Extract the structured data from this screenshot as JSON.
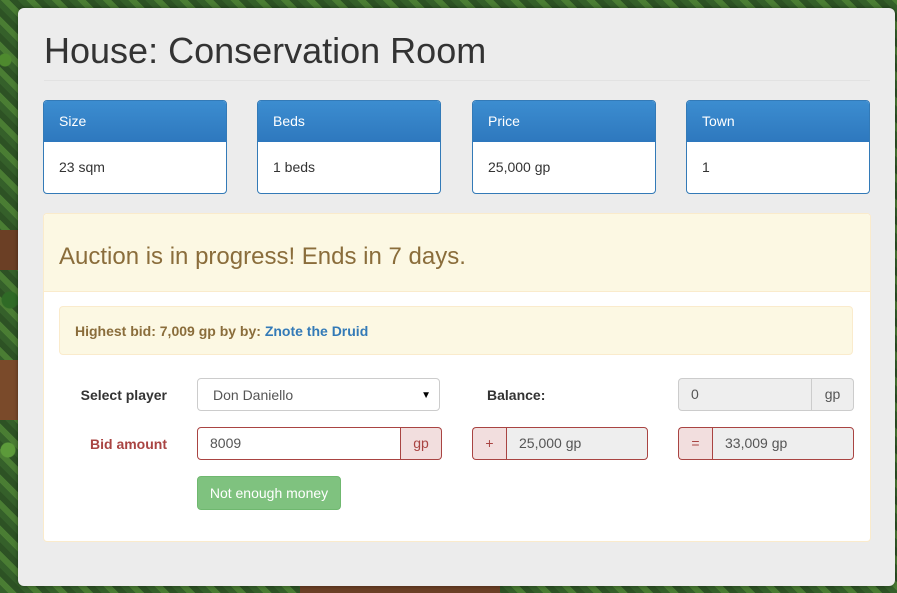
{
  "page": {
    "title": "House: Conservation Room"
  },
  "stats": [
    {
      "label": "Size",
      "value": "23 sqm"
    },
    {
      "label": "Beds",
      "value": "1 beds"
    },
    {
      "label": "Price",
      "value": "25,000 gp"
    },
    {
      "label": "Town",
      "value": "1"
    }
  ],
  "auction": {
    "heading": "Auction is in progress! Ends in 7 days.",
    "highest_bid_text": "Highest bid: 7,009 gp by by:",
    "highest_bidder": "Znote the Druid",
    "select_player_label": "Select player",
    "selected_player": "Don Daniello",
    "balance_label": "Balance:",
    "balance_value": "0",
    "balance_unit": "gp",
    "bid_amount_label": "Bid amount",
    "bid_amount_value": "8009",
    "bid_unit": "gp",
    "plus_symbol": "+",
    "plus_value": "25,000 gp",
    "equals_symbol": "=",
    "total_value": "33,009 gp",
    "submit_label": "Not enough money"
  },
  "colors": {
    "primary": "#337ab7",
    "warning_bg": "#fcf8e3",
    "warning_text": "#8a6d3b",
    "error": "#a94442",
    "success_disabled": "#7fc27f"
  }
}
